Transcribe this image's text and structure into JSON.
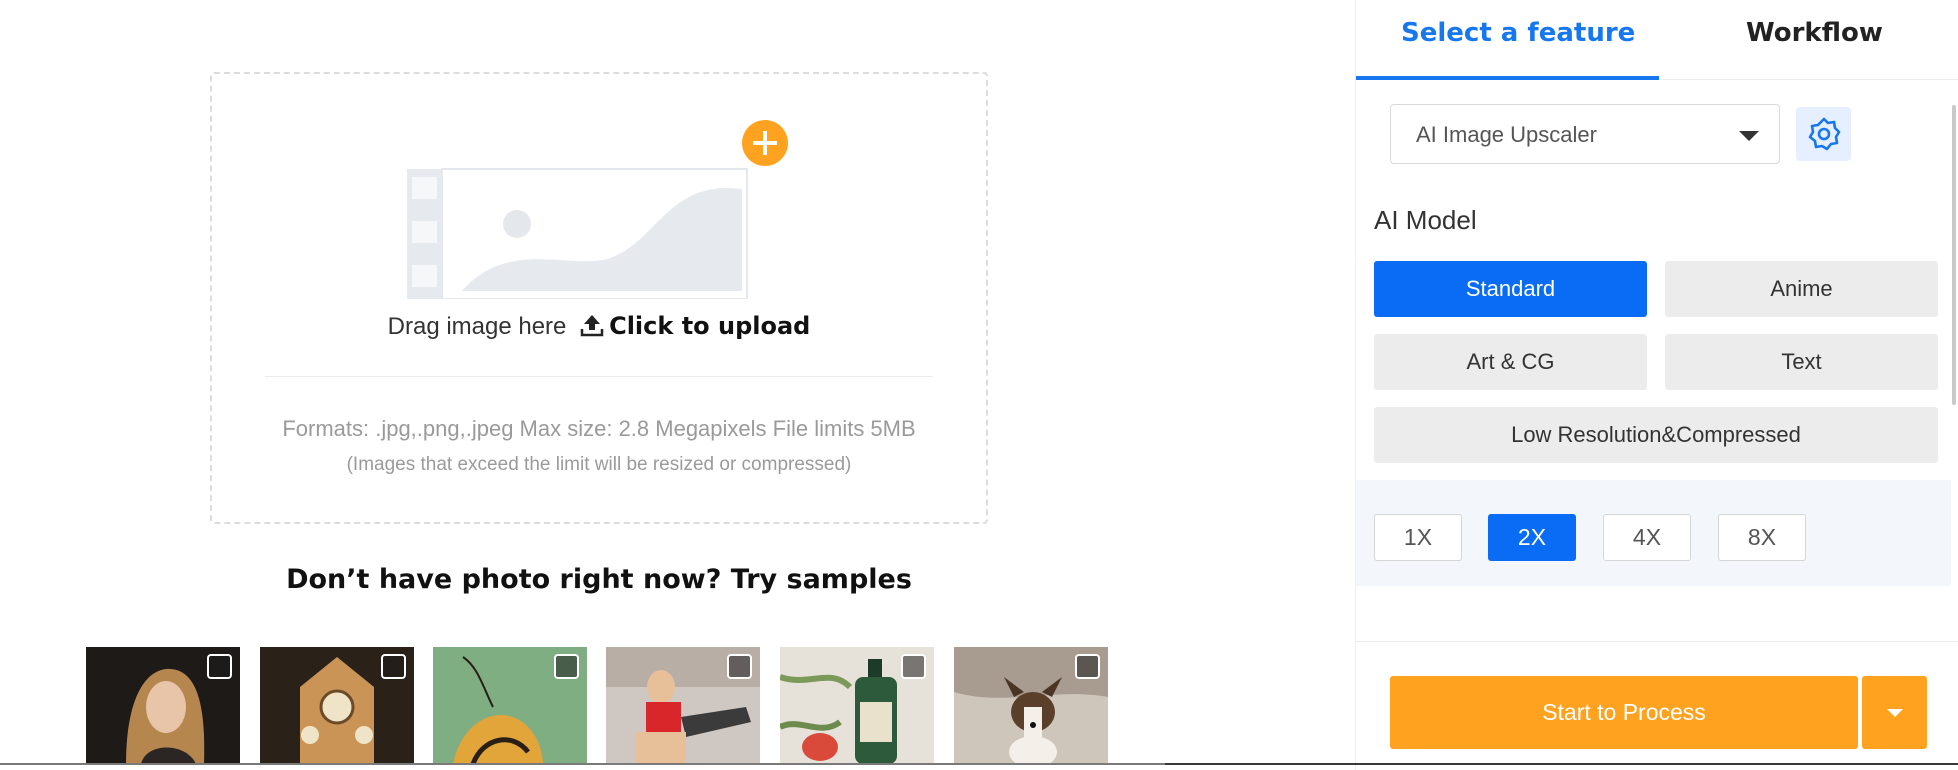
{
  "upload": {
    "drag_text": "Drag image here",
    "upload_icon": "upload-icon",
    "click_text": "Click to upload",
    "formats": "Formats: .jpg,.png,.jpeg Max size: 2.8 Megapixels File limits 5MB",
    "formats_note": "(Images that exceed the limit will be resized or compressed)",
    "add_icon": "plus-icon",
    "accent": "#ffa21f"
  },
  "samples": {
    "title": "Don’t have photo right now? Try samples",
    "items": [
      {
        "name": "woman-portrait"
      },
      {
        "name": "clock-tower"
      },
      {
        "name": "butterfly"
      },
      {
        "name": "fitness-woman"
      },
      {
        "name": "cosmetic-bottle"
      },
      {
        "name": "dog"
      }
    ]
  },
  "panel": {
    "tabs": [
      {
        "label": "Select a feature",
        "active": true
      },
      {
        "label": "Workflow",
        "active": false
      }
    ],
    "feature_select": {
      "value": "AI Image Upscaler",
      "icon": "chevron-down-icon"
    },
    "settings_icon": "gear-icon",
    "model_label": "AI Model",
    "models": [
      {
        "label": "Standard",
        "active": true
      },
      {
        "label": "Anime",
        "active": false
      },
      {
        "label": "Art & CG",
        "active": false
      },
      {
        "label": "Text",
        "active": false
      },
      {
        "label": "Low Resolution&Compressed",
        "active": false
      }
    ],
    "scales": [
      {
        "label": "1X",
        "active": false
      },
      {
        "label": "2X",
        "active": true
      },
      {
        "label": "4X",
        "active": false
      },
      {
        "label": "8X",
        "active": false
      }
    ],
    "process_label": "Start to Process",
    "primary_color": "#0a6cf5",
    "tab_color": "#1677ef"
  }
}
